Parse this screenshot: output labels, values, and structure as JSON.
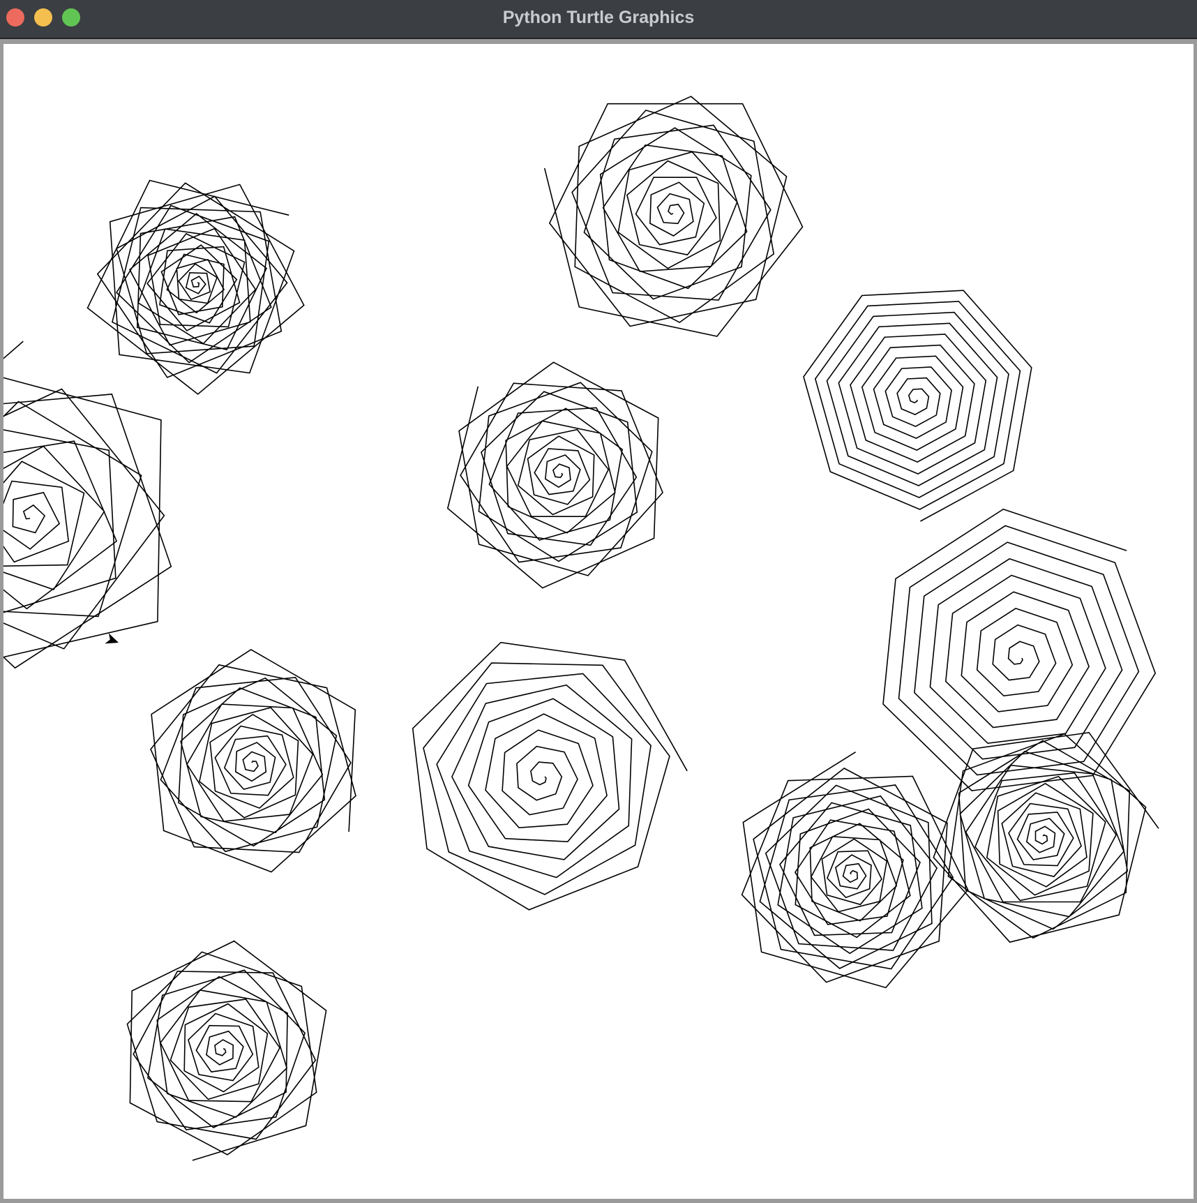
{
  "window": {
    "title": "Python Turtle Graphics",
    "controls": [
      "close-button",
      "minimize-button",
      "zoom-button"
    ],
    "colors": {
      "titlebar": "#3b3e42",
      "close": "#ed6a5e",
      "minimize": "#f5bf4f",
      "zoom": "#61c554",
      "canvas": "#ffffff",
      "pen": "#000000"
    }
  },
  "canvas": {
    "turtle_cursor": "arrow-turtle-icon",
    "spirals": [
      {
        "sides": 5,
        "turn_extra": 6
      },
      {
        "sides": 6,
        "turn_extra": 4
      },
      {
        "sides": 5,
        "turn_extra": 4
      },
      {
        "sides": 6,
        "turn_extra": 4
      },
      {
        "sides": 7,
        "turn_extra": 0
      },
      {
        "sides": 6,
        "turn_extra": 3
      },
      {
        "sides": 7,
        "turn_extra": 1
      },
      {
        "sides": 7,
        "turn_extra": 0
      },
      {
        "sides": 6,
        "turn_extra": 6
      },
      {
        "sides": 6,
        "turn_extra": 2
      },
      {
        "sides": 6,
        "turn_extra": 3
      }
    ]
  }
}
